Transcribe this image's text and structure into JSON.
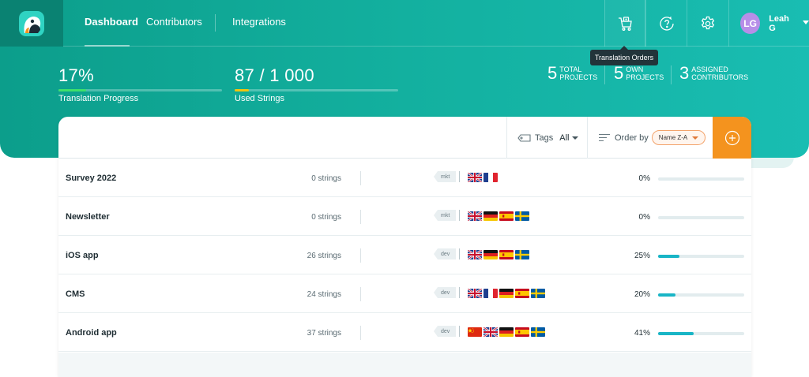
{
  "nav": {
    "links": [
      {
        "label": "Dashboard",
        "active": true
      },
      {
        "label": "Contributors",
        "active": false
      },
      {
        "label": "Integrations",
        "active": false
      }
    ],
    "icons": [
      "cart-icon",
      "help-icon",
      "gear-icon"
    ],
    "tooltip": "Translation Orders",
    "user": {
      "initials": "LG",
      "name": "Leah G"
    }
  },
  "stats": {
    "progress": {
      "value": "17%",
      "label": "Translation Progress",
      "fraction": 0.17,
      "color": "#3fe06b"
    },
    "strings": {
      "value": "87 / 1 000",
      "label": "Used Strings",
      "fraction": 0.087,
      "color": "#f1c40f"
    }
  },
  "summary": [
    {
      "num": "5",
      "label": "TOTAL\nPROJECTS"
    },
    {
      "num": "5",
      "label": "OWN\nPROJECTS"
    },
    {
      "num": "3",
      "label": "ASSIGNED\nCONTRIBUTORS"
    }
  ],
  "toolbar": {
    "tags_label": "Tags",
    "tags_value": "All",
    "order_label": "Order by",
    "order_value": "Name Z-A"
  },
  "projects": [
    {
      "name": "Survey 2022",
      "strings": "0 strings",
      "tag": "mkt",
      "flags": [
        "gb",
        "fr"
      ],
      "pct_label": "0%",
      "progress": 0
    },
    {
      "name": "Newsletter",
      "strings": "0 strings",
      "tag": "mkt",
      "flags": [
        "gb",
        "de",
        "es",
        "se"
      ],
      "pct_label": "0%",
      "progress": 0
    },
    {
      "name": "iOS app",
      "strings": "26 strings",
      "tag": "dev",
      "flags": [
        "gb",
        "de",
        "es",
        "se"
      ],
      "pct_label": "25%",
      "progress": 0.25
    },
    {
      "name": "CMS",
      "strings": "24 strings",
      "tag": "dev",
      "flags": [
        "gb",
        "fr",
        "de",
        "es",
        "se"
      ],
      "pct_label": "20%",
      "progress": 0.2
    },
    {
      "name": "Android app",
      "strings": "37 strings",
      "tag": "dev",
      "flags": [
        "cn",
        "gb",
        "de",
        "es",
        "se"
      ],
      "pct_label": "41%",
      "progress": 0.41
    }
  ]
}
